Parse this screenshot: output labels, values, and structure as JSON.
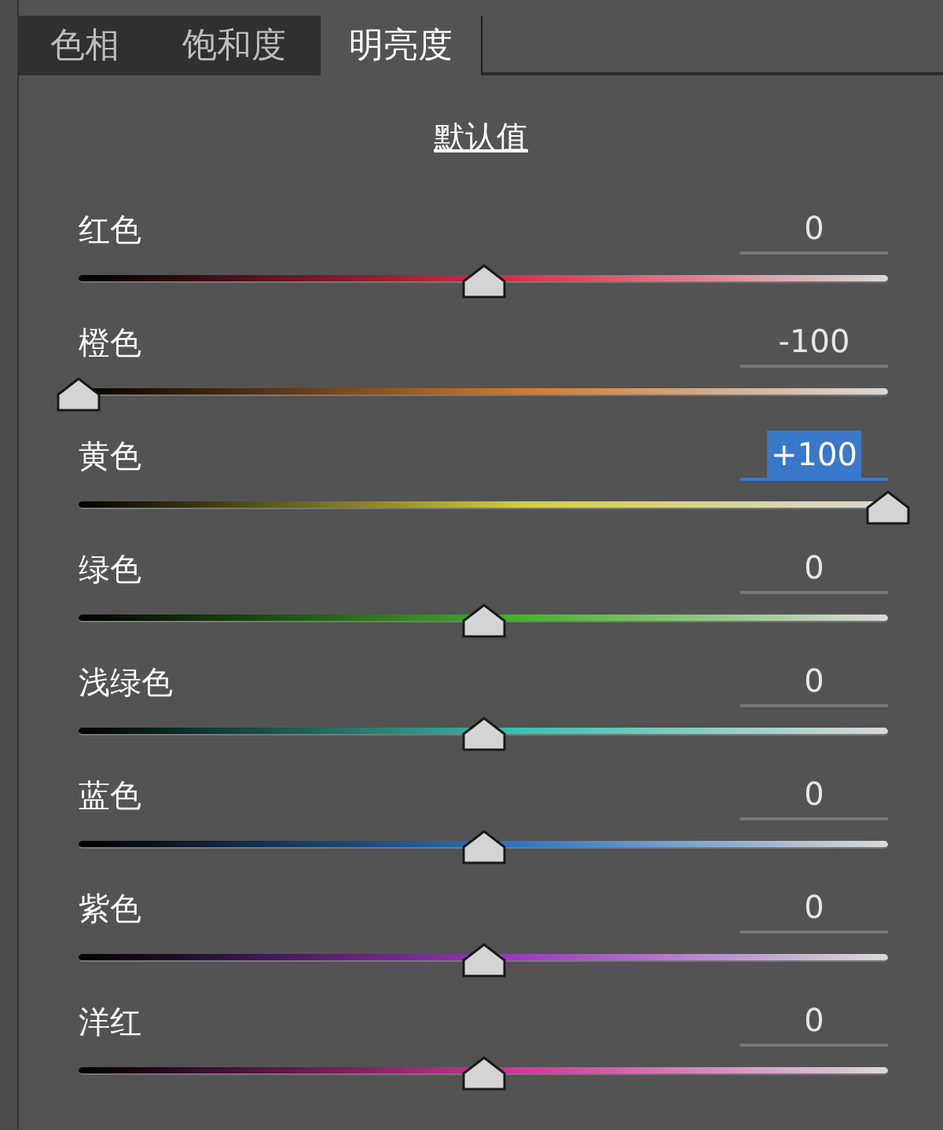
{
  "tabs": [
    {
      "label": "色相",
      "selected": false
    },
    {
      "label": "饱和度",
      "selected": false
    },
    {
      "label": "明亮度",
      "selected": true
    }
  ],
  "default_link": "默认值",
  "sliders": [
    {
      "name": "红色",
      "value": "0",
      "level": 0.5,
      "color": "#d8344e",
      "focused": false
    },
    {
      "name": "橙色",
      "value": "-100",
      "level": 0,
      "color": "#d27a2c",
      "focused": false
    },
    {
      "name": "黄色",
      "value": "+100",
      "level": 1,
      "color": "#d6cf3a",
      "focused": true
    },
    {
      "name": "绿色",
      "value": "0",
      "level": 0.5,
      "color": "#46b52a",
      "focused": false
    },
    {
      "name": "浅绿色",
      "value": "0",
      "level": 0.5,
      "color": "#3cc1b1",
      "focused": false
    },
    {
      "name": "蓝色",
      "value": "0",
      "level": 0.5,
      "color": "#2f77c4",
      "focused": false
    },
    {
      "name": "紫色",
      "value": "0",
      "level": 0.5,
      "color": "#9b3bc4",
      "focused": false
    },
    {
      "name": "洋红",
      "value": "0",
      "level": 0.5,
      "color": "#d2379b",
      "focused": false
    }
  ]
}
